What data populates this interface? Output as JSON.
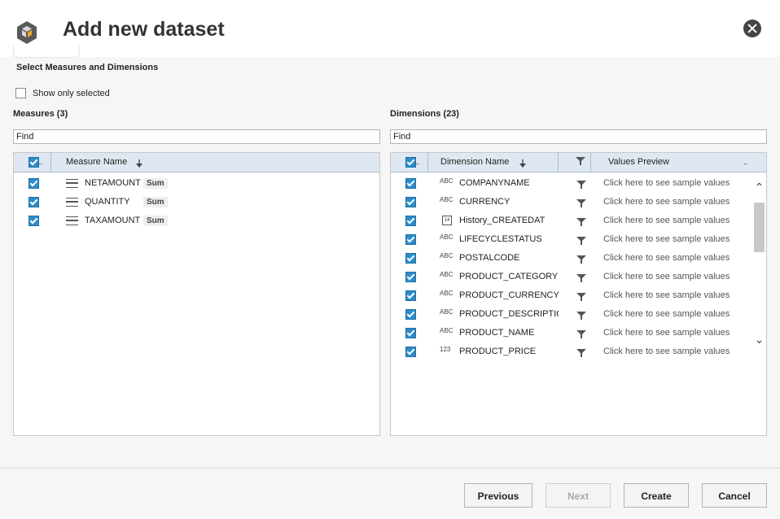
{
  "header": {
    "title": "Add new dataset",
    "logo_icon": "cube-logo-icon",
    "close_icon": "close-icon"
  },
  "section_title": "Select Measures and Dimensions",
  "show_only_selected": {
    "label": "Show only selected",
    "checked": false
  },
  "measures": {
    "label": "Measures (3)",
    "find_value": "Find",
    "header": {
      "select_all_dots": "...",
      "name_col": "Measure Name",
      "sort_icon": "sort-down-icon"
    },
    "rows": [
      {
        "checked": true,
        "icon": "measure-icon",
        "name": "NETAMOUNT",
        "agg": "Sum"
      },
      {
        "checked": true,
        "icon": "measure-icon",
        "name": "QUANTITY",
        "agg": "Sum"
      },
      {
        "checked": true,
        "icon": "measure-icon",
        "name": "TAXAMOUNT",
        "agg": "Sum"
      }
    ]
  },
  "dimensions": {
    "label": "Dimensions (23)",
    "find_value": "Find",
    "header": {
      "select_all_dots": "...",
      "name_col": "Dimension Name",
      "filter_icon": "filter-icon",
      "preview_col": "Values Preview",
      "preview_dots": "...",
      "sort_icon": "sort-down-icon"
    },
    "rows": [
      {
        "checked": true,
        "type": "ABC",
        "name": "COMPANYNAME",
        "preview": "Click here to see sample values"
      },
      {
        "checked": true,
        "type": "ABC",
        "name": "CURRENCY",
        "preview": "Click here to see sample values"
      },
      {
        "checked": true,
        "type": "14",
        "type_icon": "calendar-icon",
        "name": "History_CREATEDAT",
        "preview": "Click here to see sample values"
      },
      {
        "checked": true,
        "type": "ABC",
        "name": "LIFECYCLESTATUS",
        "preview": "Click here to see sample values"
      },
      {
        "checked": true,
        "type": "ABC",
        "name": "POSTALCODE",
        "preview": "Click here to see sample values"
      },
      {
        "checked": true,
        "type": "ABC",
        "name": "PRODUCT_CATEGORY",
        "preview": "Click here to see sample values"
      },
      {
        "checked": true,
        "type": "ABC",
        "name": "PRODUCT_CURRENCY",
        "preview": "Click here to see sample values"
      },
      {
        "checked": true,
        "type": "ABC",
        "name": "PRODUCT_DESCRIPTION",
        "preview": "Click here to see sample values"
      },
      {
        "checked": true,
        "type": "ABC",
        "name": "PRODUCT_NAME",
        "preview": "Click here to see sample values"
      },
      {
        "checked": true,
        "type": "123",
        "name": "PRODUCT_PRICE",
        "preview": "Click here to see sample values"
      }
    ],
    "scrollbar": {
      "up_icon": "chevron-up-icon",
      "down_icon": "chevron-down-icon",
      "up_glyph": "⌃",
      "down_glyph": "⌄"
    }
  },
  "footer": {
    "previous_label": "Previous",
    "next_label": "Next",
    "create_label": "Create",
    "cancel_label": "Cancel"
  }
}
